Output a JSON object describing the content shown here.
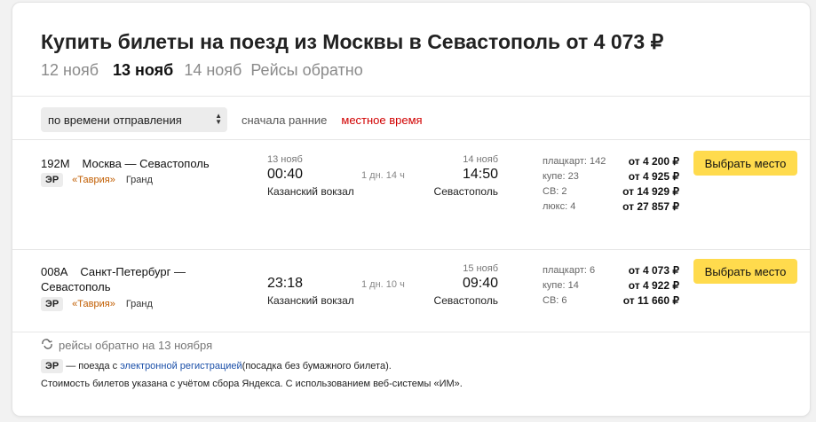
{
  "title": "Купить билеты на поезд из Москвы в Севастополь от 4 073 ₽",
  "date_tabs": [
    "12 нояб",
    "13 нояб",
    "14 нояб",
    "Рейсы обратно"
  ],
  "sort": {
    "select_value": "по времени отправления",
    "secondary": "сначала ранние",
    "local_time": "местное время"
  },
  "trains": [
    {
      "number": "192М",
      "route": "Москва — Севастополь",
      "er": "ЭР",
      "brand": "«Таврия»",
      "klass": "Гранд",
      "dep_date": "13 нояб",
      "dep_time": "00:40",
      "dep_station": "Казанский вокзал",
      "duration": "1 дн. 14 ч",
      "arr_date": "14 нояб",
      "arr_time": "14:50",
      "arr_station": "Севастополь",
      "classes": [
        "плацкарт: 142",
        "купе: 23",
        "СВ: 2",
        "люкс: 4"
      ],
      "prices": [
        "от 4 200 ₽",
        "от 4 925 ₽",
        "от 14 929 ₽",
        "от 27 857 ₽"
      ],
      "button": "Выбрать место"
    },
    {
      "number": "008А",
      "route_line1": "Санкт-Петербург —",
      "route_line2": "Севастополь",
      "er": "ЭР",
      "brand": "«Таврия»",
      "klass": "Гранд",
      "dep_time": "23:18",
      "dep_station": "Казанский вокзал",
      "duration": "1 дн. 10 ч",
      "arr_date": "15 нояб",
      "arr_time": "09:40",
      "arr_station": "Севастополь",
      "classes": [
        "плацкарт: 6",
        "купе: 14",
        "СВ: 6"
      ],
      "prices": [
        "от 4 073 ₽",
        "от 4 922 ₽",
        "от 11 660 ₽"
      ],
      "button": "Выбрать место"
    }
  ],
  "footer": {
    "back_link": "рейсы обратно на 13 ноября",
    "er_badge": "ЭР",
    "er_text_before": " — поезда с ",
    "er_link": "электронной регистрацией",
    "er_text_after": " (посадка без бумажного билета).",
    "note": "Стоимость билетов указана с учётом сбора Яндекса. С использованием веб-системы «ИМ»."
  },
  "colors": {
    "button": "#ffdb4d",
    "accent_red": "#d10000",
    "brand_orange": "#c15d00",
    "link_blue": "#1a4fa8"
  }
}
